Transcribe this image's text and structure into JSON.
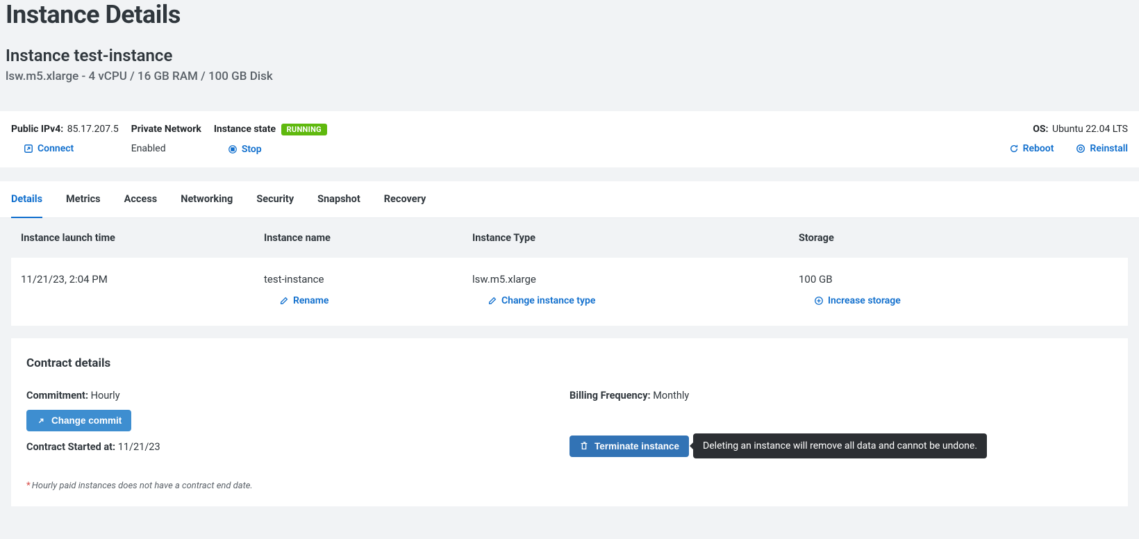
{
  "header": {
    "title": "Instance Details",
    "instance_name": "Instance test-instance",
    "spec": "lsw.m5.xlarge - 4 vCPU / 16 GB RAM / 100 GB Disk"
  },
  "status": {
    "public_ipv4_label": "Public IPv4:",
    "public_ipv4": "85.17.207.5",
    "connect": "Connect",
    "private_network_label": "Private Network",
    "private_network": "Enabled",
    "instance_state_label": "Instance state",
    "running_badge": "RUNNING",
    "stop": "Stop",
    "os_label": "OS:",
    "os": "Ubuntu 22.04 LTS",
    "reboot": "Reboot",
    "reinstall": "Reinstall"
  },
  "tabs": {
    "details": "Details",
    "metrics": "Metrics",
    "access": "Access",
    "networking": "Networking",
    "security": "Security",
    "snapshot": "Snapshot",
    "recovery": "Recovery"
  },
  "details_table": {
    "headers": {
      "launch_time": "Instance launch time",
      "name": "Instance name",
      "type": "Instance Type",
      "storage": "Storage"
    },
    "row": {
      "launch_time": "11/21/23, 2:04 PM",
      "name": "test-instance",
      "type": "lsw.m5.xlarge",
      "storage": "100 GB"
    },
    "actions": {
      "rename": "Rename",
      "change_type": "Change instance type",
      "increase_storage": "Increase storage"
    }
  },
  "contract": {
    "title": "Contract details",
    "commitment_label": "Commitment:",
    "commitment": "Hourly",
    "billing_label": "Billing Frequency:",
    "billing": "Monthly",
    "change_commit": "Change commit",
    "terminate": "Terminate instance",
    "tooltip": "Deleting an instance will remove all data and cannot be undone.",
    "started_label": "Contract Started at:",
    "started": "11/21/23",
    "footnote": "Hourly paid instances does not have a contract end date."
  }
}
